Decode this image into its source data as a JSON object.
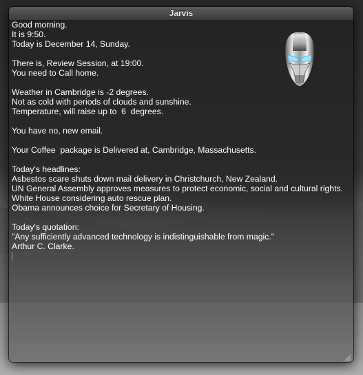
{
  "window": {
    "title": "Jarvis"
  },
  "content": {
    "greeting": "Good morning.",
    "time_line": "It is 9:50.",
    "date_line": "Today is December 14, Sunday.",
    "event_line": "There is, Review Session, at 19:00.",
    "todo_line": "You need to Call home.",
    "weather_lines": [
      "Weather in Cambridge is -2 degrees.",
      "Not as cold with periods of clouds and sunshine.",
      "Temperature, will raise up to  6  degrees."
    ],
    "email_line": "You have no, new email.",
    "package_line": "Your Coffee  package is Delivered at, Cambridge, Massachusetts.",
    "headlines_title": "Today's headlines:",
    "headlines": [
      "Asbestos scare shuts down mail delivery in Christchurch, New Zealand.",
      "UN General Assembly approves measures to protect economic, social and cultural rights.",
      "White House considering auto rescue plan.",
      "Obama announces choice for Secretary of Housing."
    ],
    "quotation_title": "Today's quotation:",
    "quotation_text": "\"Any sufficiently advanced technology is indistinguishable from magic.\"",
    "quotation_author": "Arthur C. Clarke."
  },
  "icons": {
    "avatar": "iron-man-helmet-icon",
    "resize": "resize-grip-icon"
  }
}
